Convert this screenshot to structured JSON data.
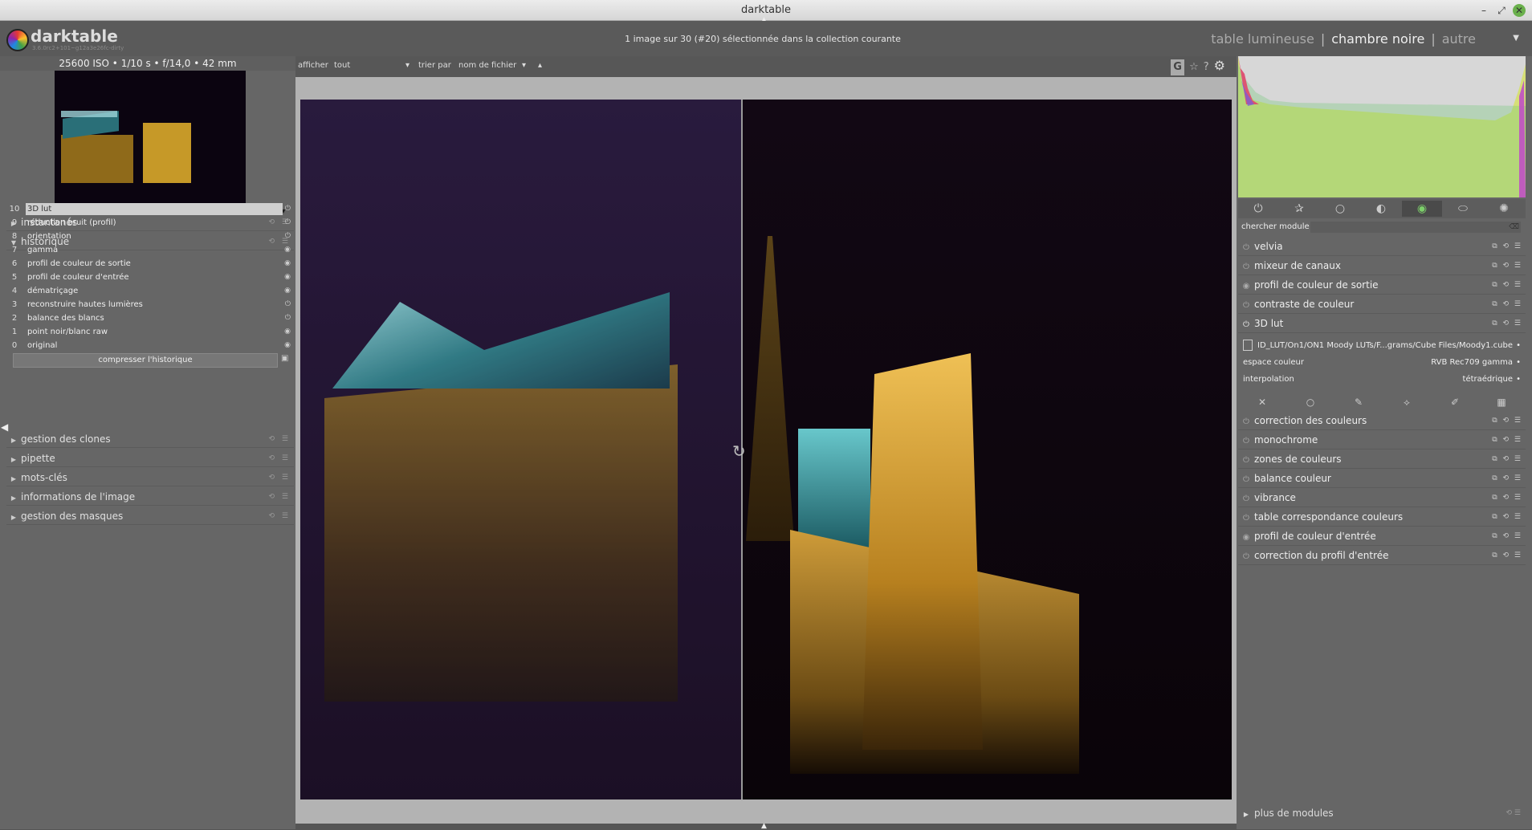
{
  "window": {
    "title": "darktable"
  },
  "app": {
    "name": "darktable",
    "version": "3.6.0rc2+101~g12a3e26fc-dirty"
  },
  "header": {
    "collection_info": "1 image sur 30 (#20) sélectionnée dans la collection courante",
    "views": [
      "table lumineuse",
      "chambre noire",
      "autre"
    ],
    "active_view": "chambre noire"
  },
  "left": {
    "exif": "25600 ISO • 1/10 s • f/14,0 • 42 mm",
    "modules_top": [
      {
        "label": "instantanés",
        "expanded": false
      },
      {
        "label": "historique",
        "expanded": true
      }
    ],
    "history": [
      {
        "num": "10",
        "label": "3D lut",
        "selected": true
      },
      {
        "num": "9",
        "label": "réduction bruit (profil)"
      },
      {
        "num": "8",
        "label": "orientation"
      },
      {
        "num": "7",
        "label": "gamma"
      },
      {
        "num": "6",
        "label": "profil de couleur de sortie"
      },
      {
        "num": "5",
        "label": "profil de couleur d'entrée"
      },
      {
        "num": "4",
        "label": "dématriçage"
      },
      {
        "num": "3",
        "label": "reconstruire hautes lumières"
      },
      {
        "num": "2",
        "label": "balance des blancs"
      },
      {
        "num": "1",
        "label": "point noir/blanc raw"
      },
      {
        "num": "0",
        "label": "original"
      }
    ],
    "compress_label": "compresser l'historique",
    "modules_bottom": [
      {
        "label": "gestion des clones"
      },
      {
        "label": "pipette"
      },
      {
        "label": "mots-clés"
      },
      {
        "label": "informations de l'image"
      },
      {
        "label": "gestion des masques"
      }
    ]
  },
  "filterbar": {
    "show_label": "afficher",
    "show_value": "tout",
    "sort_label": "trier par",
    "sort_value": "nom de fichier",
    "toggle_g": "G"
  },
  "right": {
    "search_label": "chercher module",
    "modules_a": [
      {
        "label": "velvia",
        "on": false
      },
      {
        "label": "mixeur de canaux",
        "on": false
      },
      {
        "label": "profil de couleur de sortie",
        "on": true
      },
      {
        "label": "contraste de couleur",
        "on": false
      },
      {
        "label": "3D lut",
        "on": true
      }
    ],
    "lut": {
      "file": "ID_LUT/On1/ON1 Moody LUTs/F...grams/Cube Files/Moody1.cube",
      "colorspace_label": "espace couleur",
      "colorspace_value": "RVB Rec709 gamma",
      "interp_label": "interpolation",
      "interp_value": "tétraédrique"
    },
    "modules_b": [
      {
        "label": "correction des couleurs",
        "on": false
      },
      {
        "label": "monochrome",
        "on": false
      },
      {
        "label": "zones de couleurs",
        "on": false
      },
      {
        "label": "balance couleur",
        "on": false
      },
      {
        "label": "vibrance",
        "on": false
      },
      {
        "label": "table correspondance couleurs",
        "on": false
      },
      {
        "label": "profil de couleur d'entrée",
        "on": true
      },
      {
        "label": "correction du profil d'entrée",
        "on": false
      }
    ],
    "more_label": "plus de modules"
  },
  "colors": {
    "accent": "#6ab04c",
    "panel": "#666666",
    "center": "#b3b3b3"
  }
}
